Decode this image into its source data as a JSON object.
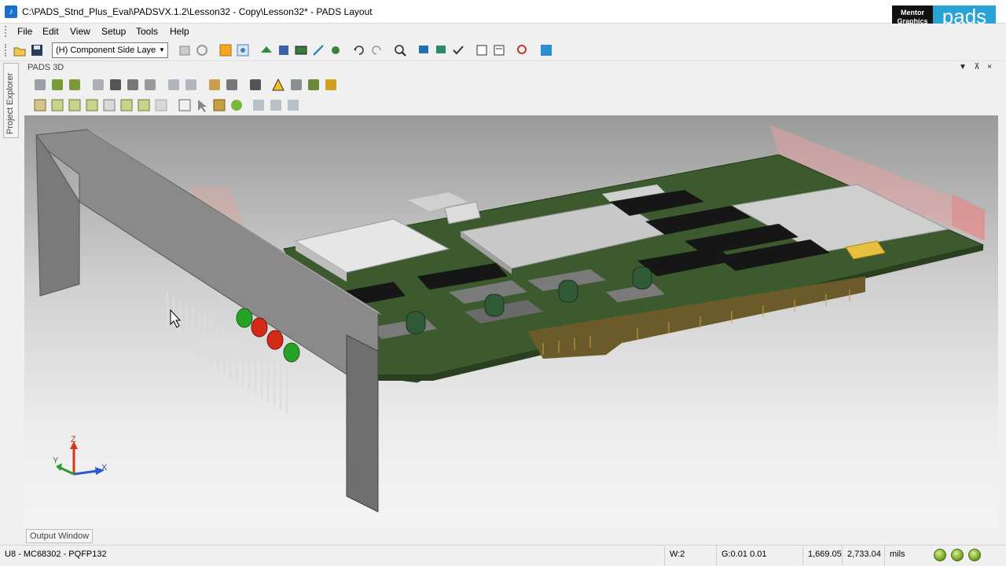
{
  "window": {
    "title": "C:\\PADS_Stnd_Plus_Eval\\PADSVX.1.2\\Lesson32 - Copy\\Lesson32* - PADS Layout",
    "brand_top": "Mentor",
    "brand_bottom": "Graphics",
    "brand_product": "pads"
  },
  "menu": {
    "items": [
      "File",
      "Edit",
      "View",
      "Setup",
      "Tools",
      "Help"
    ]
  },
  "toolbar": {
    "layer_select": "(H) Component Side Layer",
    "buttons": [
      "open-icon",
      "save-icon",
      "properties-icon",
      "refresh-icon",
      "highlight-icon",
      "find-icon",
      "route-icon",
      "pour-icon",
      "board-icon",
      "line-icon",
      "via-icon",
      "undo-icon",
      "redo-icon",
      "zoom-icon",
      "view-3d-icon",
      "view-top-icon",
      "verify-icon",
      "export-icon",
      "report-icon",
      "drc-icon",
      "layout-icon"
    ]
  },
  "side_tab": {
    "label": "Project Explorer"
  },
  "pane": {
    "title": "PADS 3D",
    "dropdown": "▼",
    "pin": "⊼",
    "close": "×"
  },
  "toolbar_3d_row1": [
    "move-icon",
    "rotate-icon",
    "rotate-all-icon",
    "copy-view-icon",
    "print-icon",
    "snapshot-icon",
    "export-model-icon",
    "zoom-area-icon",
    "print-preview-icon",
    "measure-icon",
    "collision-icon",
    "step-icon",
    "warning-icon",
    "view-icon",
    "save-view-icon",
    "settings-icon"
  ],
  "toolbar_3d_row2": [
    "iso-view-icon",
    "top-view-icon",
    "front-view-icon",
    "right-view-icon",
    "left-view-icon",
    "back-view-icon",
    "bottom-view-icon",
    "fit-icon",
    "select-icon",
    "pan-icon",
    "reset-icon",
    "explode-icon",
    "collapse-icon",
    "clip-icon"
  ],
  "axis": {
    "z": "Z",
    "y": "Y",
    "x": "X"
  },
  "output_tab": {
    "label": "Output Window"
  },
  "status": {
    "component": "U8 - MC68302 - PQFP132",
    "width": "W:2",
    "grid": "G:0.01 0.01",
    "x": "1,669.05",
    "y": "2,733.04",
    "units": "mils"
  },
  "colors": {
    "board_green": "#3c5a2e",
    "bracket_gray": "#8a8a8a",
    "led_green": "#27a227",
    "led_red": "#d42a1a",
    "brand_blue": "#29a3d6"
  }
}
